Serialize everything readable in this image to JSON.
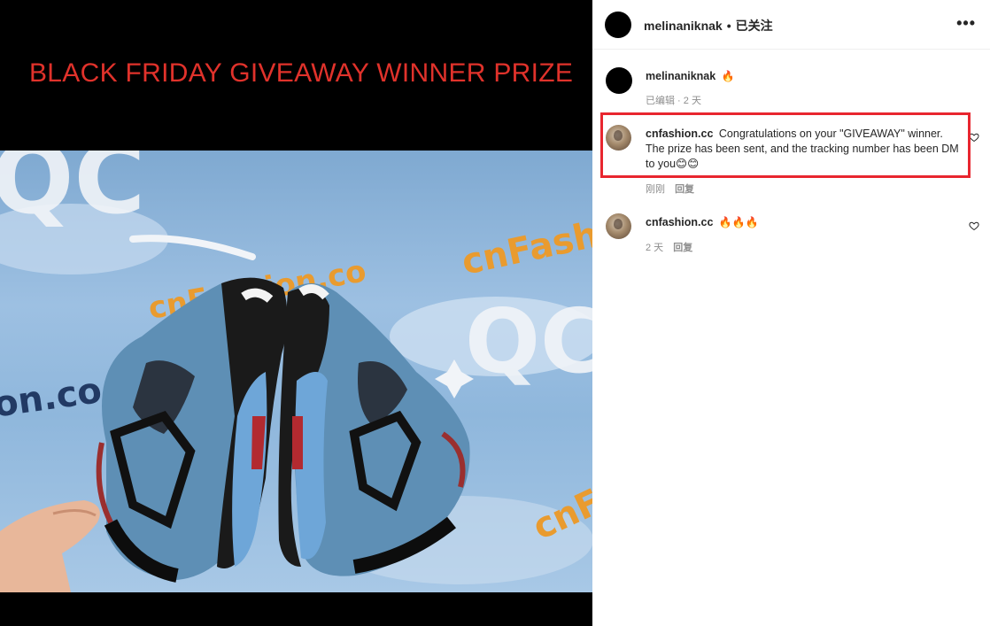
{
  "banner": {
    "title": "BLACK FRIDAY GIVEAWAY WINNER PRIZE"
  },
  "photo": {
    "watermarks": [
      "QC",
      "cnFashion.co",
      "cnFashio",
      "on.co",
      "QC",
      "cnF"
    ]
  },
  "header": {
    "username": "melinaniknak",
    "separator": "•",
    "follow_status": "已关注",
    "more_label": "•••"
  },
  "comments": [
    {
      "username": "melinaniknak",
      "text": "🔥",
      "time": "已编辑 · 2 天",
      "reply_label": ""
    },
    {
      "username": "cnfashion.cc",
      "text": "Congratulations on your \"GIVEAWAY\" winner. The prize has been sent, and the tracking number has been DM to you😊😊",
      "time": "刚刚",
      "reply_label": "回复"
    },
    {
      "username": "cnfashion.cc",
      "text": "🔥🔥🔥",
      "time": "2 天",
      "reply_label": "回复"
    }
  ],
  "colors": {
    "banner_red": "#e0322b",
    "highlight_red": "#e8262f",
    "shoe_blue": "#5e8fb5",
    "sky_blue": "#8fb7dc"
  }
}
